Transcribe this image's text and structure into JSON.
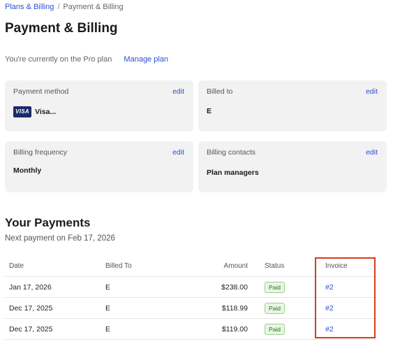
{
  "breadcrumb": {
    "parent": "Plans & Billing",
    "current": "Payment & Billing"
  },
  "page_title": "Payment & Billing",
  "plan": {
    "text": "You're currently on the Pro plan",
    "manage_label": "Manage plan"
  },
  "cards": {
    "payment_method": {
      "label": "Payment method",
      "edit": "edit",
      "card_brand": "VISA",
      "value": "Visa..."
    },
    "billed_to": {
      "label": "Billed to",
      "edit": "edit",
      "value": "E"
    },
    "billing_frequency": {
      "label": "Billing frequency",
      "edit": "edit",
      "value": "Monthly"
    },
    "billing_contacts": {
      "label": "Billing contacts",
      "edit": "edit",
      "value": "Plan managers"
    }
  },
  "payments": {
    "title": "Your Payments",
    "next_payment": "Next payment on Feb 17, 2026",
    "columns": {
      "date": "Date",
      "billed_to": "Billed To",
      "amount": "Amount",
      "status": "Status",
      "invoice": "Invoice"
    },
    "rows": [
      {
        "date": "Jan 17, 2026",
        "billed_to": "E",
        "amount": "$238.00",
        "status": "Paid",
        "invoice": "#2"
      },
      {
        "date": "Dec 17, 2025",
        "billed_to": "E",
        "amount": "$118.99",
        "status": "Paid",
        "invoice": "#2"
      },
      {
        "date": "Dec 17, 2025",
        "billed_to": "E",
        "amount": "$119.00",
        "status": "Paid",
        "invoice": "#2"
      }
    ]
  },
  "colors": {
    "link": "#2a4fd6",
    "card_bg": "#f2f2f2",
    "paid_badge_bg": "#e9f6e2",
    "highlight_border": "#d63a1f"
  }
}
